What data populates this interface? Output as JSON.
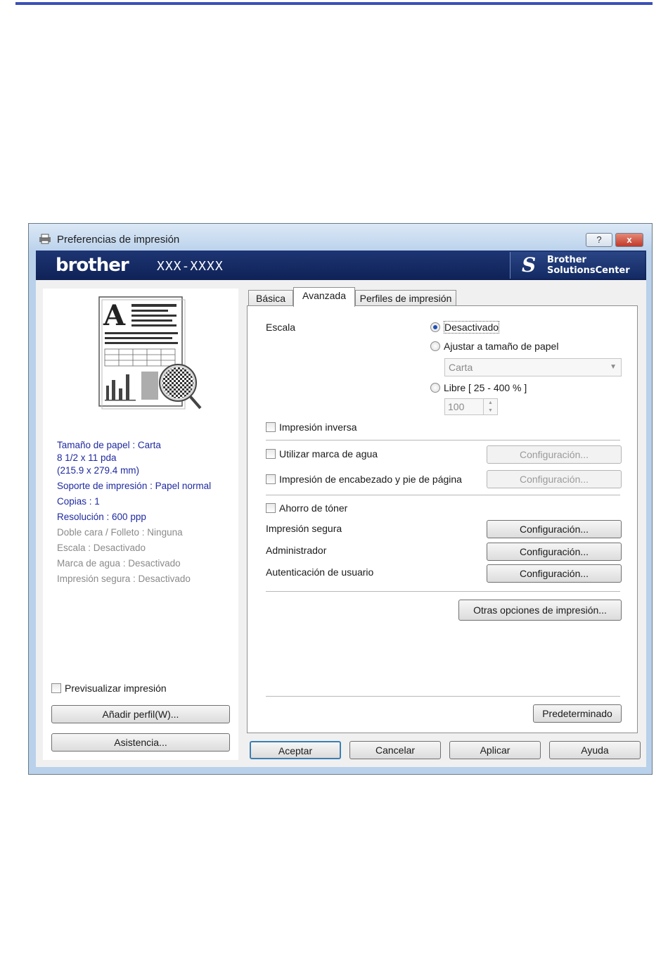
{
  "window": {
    "title": "Preferencias de impresión",
    "help_label": "?",
    "close_label": "x"
  },
  "brand": {
    "logo": "brother",
    "model": "XXX-XXXX",
    "solutions_line1": "Brother",
    "solutions_line2": "SolutionsCenter"
  },
  "left": {
    "info": {
      "paper_size": "Tamaño de papel : Carta",
      "paper_dim1": "8 1/2 x 11 pda",
      "paper_dim2": "(215.9 x 279.4 mm)",
      "media": "Soporte de impresión : Papel normal",
      "copies": "Copias : 1",
      "resolution": "Resolución : 600 ppp",
      "duplex": "Doble cara / Folleto : Ninguna",
      "scale": "Escala : Desactivado",
      "watermark": "Marca de agua : Desactivado",
      "secure": "Impresión segura : Desactivado"
    },
    "preview_check": "Previsualizar impresión",
    "add_profile": "Añadir perfil(W)...",
    "support": "Asistencia..."
  },
  "tabs": [
    {
      "label": "Básica",
      "active": false
    },
    {
      "label": "Avanzada",
      "active": true
    },
    {
      "label": "Perfiles de impresión",
      "active": false
    }
  ],
  "advanced": {
    "scale_label": "Escala",
    "scale_off": "Desactivado",
    "scale_fit": "Ajustar a tamaño de papel",
    "fit_select_value": "Carta",
    "scale_free": "Libre [ 25 - 400 % ]",
    "free_value": "100",
    "reverse_print": "Impresión inversa",
    "use_watermark": "Utilizar marca de agua",
    "header_footer": "Impresión de encabezado y pie de página",
    "toner_save": "Ahorro de tóner",
    "secure_print": "Impresión segura",
    "administrator": "Administrador",
    "user_auth": "Autenticación de usuario",
    "config_label": "Configuración...",
    "other_options": "Otras opciones de impresión...",
    "default": "Predeterminado"
  },
  "footer": {
    "ok": "Aceptar",
    "cancel": "Cancelar",
    "apply": "Aplicar",
    "help": "Ayuda"
  }
}
